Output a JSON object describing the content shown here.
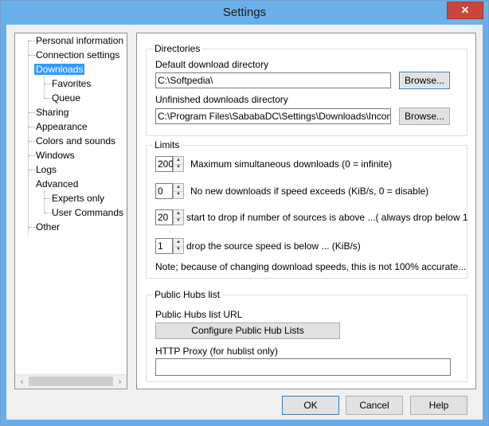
{
  "window": {
    "title": "Settings",
    "close_glyph": "✕"
  },
  "tree": {
    "items": [
      {
        "label": "Personal information",
        "level": 0
      },
      {
        "label": "Connection settings",
        "level": 0
      },
      {
        "label": "Downloads",
        "level": 0,
        "expanded": true,
        "selected": true
      },
      {
        "label": "Favorites",
        "level": 1
      },
      {
        "label": "Queue",
        "level": 1
      },
      {
        "label": "Sharing",
        "level": 0
      },
      {
        "label": "Appearance",
        "level": 0
      },
      {
        "label": "Colors and sounds",
        "level": 0
      },
      {
        "label": "Windows",
        "level": 0
      },
      {
        "label": "Logs",
        "level": 0
      },
      {
        "label": "Advanced",
        "level": 0,
        "expanded": true
      },
      {
        "label": "Experts only",
        "level": 1
      },
      {
        "label": "User Commands",
        "level": 1
      },
      {
        "label": "Other",
        "level": 0
      }
    ],
    "scroll_left": "‹",
    "scroll_right": "›"
  },
  "directories": {
    "group_label": "Directories",
    "default_label": "Default download directory",
    "default_value": "C:\\Softpedia\\",
    "unfinished_label": "Unfinished downloads directory",
    "unfinished_value": "C:\\Program Files\\SababaDC\\Settings\\Downloads\\Incomplete\\",
    "browse_label": "Browse..."
  },
  "limits": {
    "group_label": "Limits",
    "rows": [
      {
        "value": "200",
        "text": "Maximum simultaneous downloads (0 = infinite)"
      },
      {
        "value": "0",
        "text": "No new downloads if speed exceeds (KiB/s, 0 = disable)"
      },
      {
        "value": "20",
        "text": "start to drop if number of sources is above ...( always drop below 1"
      },
      {
        "value": "1",
        "text": "drop the source speed is below ... (KiB/s)"
      }
    ],
    "note": "Note; because of changing download speeds, this is not 100% accurate..."
  },
  "hubs": {
    "group_label": "Public Hubs list",
    "url_label": "Public Hubs list URL",
    "configure_button": "Configure Public Hub Lists",
    "proxy_label": "HTTP Proxy (for hublist only)",
    "proxy_value": ""
  },
  "footer": {
    "ok": "OK",
    "cancel": "Cancel",
    "help": "Help"
  }
}
